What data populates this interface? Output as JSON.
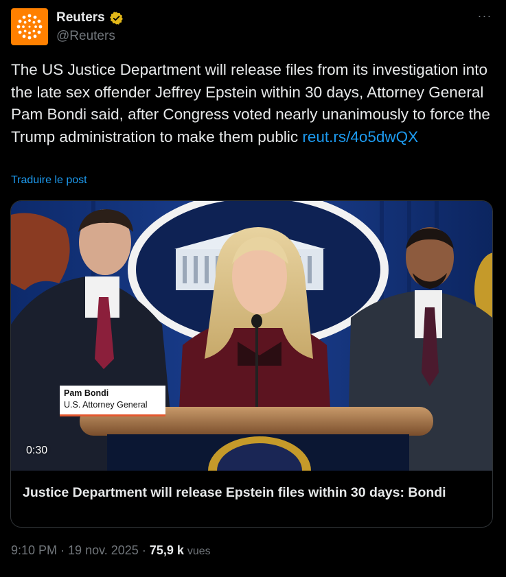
{
  "author": {
    "name": "Reuters",
    "handle": "@Reuters",
    "verified_badge_color": "#e2b719",
    "avatar_color": "#ff8000"
  },
  "more_menu_label": "···",
  "tweet": {
    "text": "The US Justice Department will release files from its investigation into the late sex offender Jeffrey Epstein within 30 days, Attorney General Pam Bondi said, after Congress voted nearly unanimously to force the Trump administration to make them public ",
    "link": "reut.rs/4o5dwQX"
  },
  "translate_label": "Traduire le post",
  "video": {
    "lower_third_name": "Pam Bondi",
    "lower_third_title": "U.S. Attorney General",
    "duration": "0:30",
    "card_title": "Justice Department will release Epstein files within 30 days: Bondi"
  },
  "meta": {
    "time": "9:10 PM",
    "separator": " · ",
    "date": "19 nov. 2025",
    "views_count": "75,9 k",
    "views_label": "vues"
  },
  "colors": {
    "background": "#000000",
    "text_primary": "#e7e9ea",
    "text_secondary": "#71767b",
    "link": "#1d9bf0",
    "border": "#2f3336"
  }
}
